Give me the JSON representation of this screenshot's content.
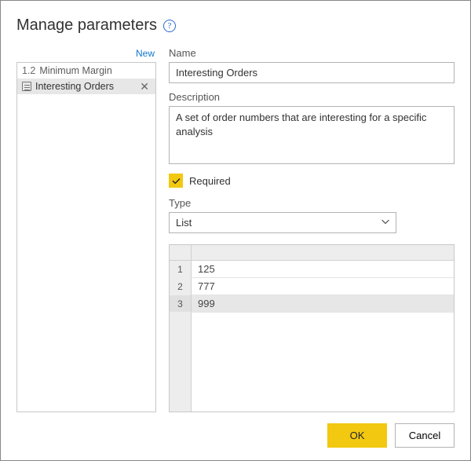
{
  "title": "Manage parameters",
  "new_link": "New",
  "sidebar": {
    "items": [
      {
        "prefix": "1.2",
        "label": "Minimum Margin",
        "icon": "numeric",
        "selected": false
      },
      {
        "prefix": "",
        "label": "Interesting Orders",
        "icon": "list",
        "selected": true
      }
    ]
  },
  "form": {
    "name_label": "Name",
    "name_value": "Interesting Orders",
    "description_label": "Description",
    "description_value": "A set of order numbers that are interesting for a specific analysis",
    "required_label": "Required",
    "required_checked": true,
    "type_label": "Type",
    "type_value": "List"
  },
  "chart_data": {
    "type": "table",
    "columns": [
      "value"
    ],
    "rows": [
      {
        "index": 1,
        "value": "125",
        "selected": false
      },
      {
        "index": 2,
        "value": "777",
        "selected": false
      },
      {
        "index": 3,
        "value": "999",
        "selected": true
      }
    ]
  },
  "footer": {
    "ok": "OK",
    "cancel": "Cancel"
  }
}
